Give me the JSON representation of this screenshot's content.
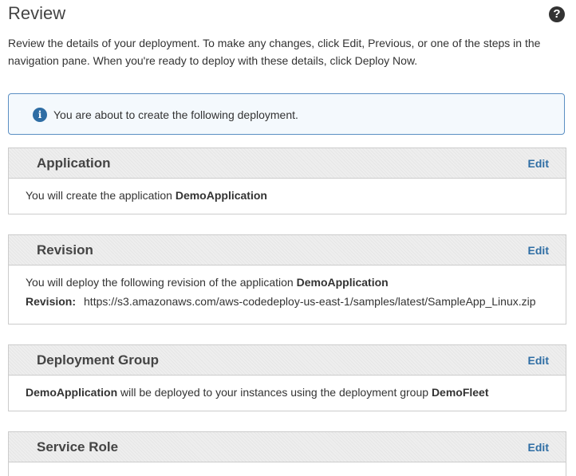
{
  "header": {
    "title": "Review",
    "help_icon": "question-circle-icon",
    "help_glyph": "?"
  },
  "intro": {
    "line1": "Review the details of your deployment. To make any changes, click Edit, Previous, or one of the steps in the",
    "line2": "navigation pane. When you're ready to deploy with these details, click Deploy Now."
  },
  "info_banner": {
    "icon": "info-circle-icon",
    "glyph": "i",
    "text": "You are about to create the following deployment."
  },
  "sections": {
    "application": {
      "title": "Application",
      "edit_label": "Edit",
      "text_prefix": "You will create the application ",
      "app_name": "DemoApplication"
    },
    "revision": {
      "title": "Revision",
      "edit_label": "Edit",
      "text_prefix": "You will deploy the following revision of the application ",
      "app_name": "DemoApplication",
      "revision_label": "Revision:",
      "revision_value": "https://s3.amazonaws.com/aws-codedeploy-us-east-1/samples/latest/SampleApp_Linux.zip"
    },
    "deployment_group": {
      "title": "Deployment Group",
      "edit_label": "Edit",
      "app_name": "DemoApplication",
      "text_middle": " will be deployed to your instances using the deployment group ",
      "group_name": "DemoFleet"
    },
    "service_role": {
      "title": "Service Role",
      "edit_label": "Edit"
    }
  },
  "colors": {
    "link": "#2e6da4",
    "info_border": "#5b8fc3",
    "section_header_bg": "#eeeeee"
  }
}
